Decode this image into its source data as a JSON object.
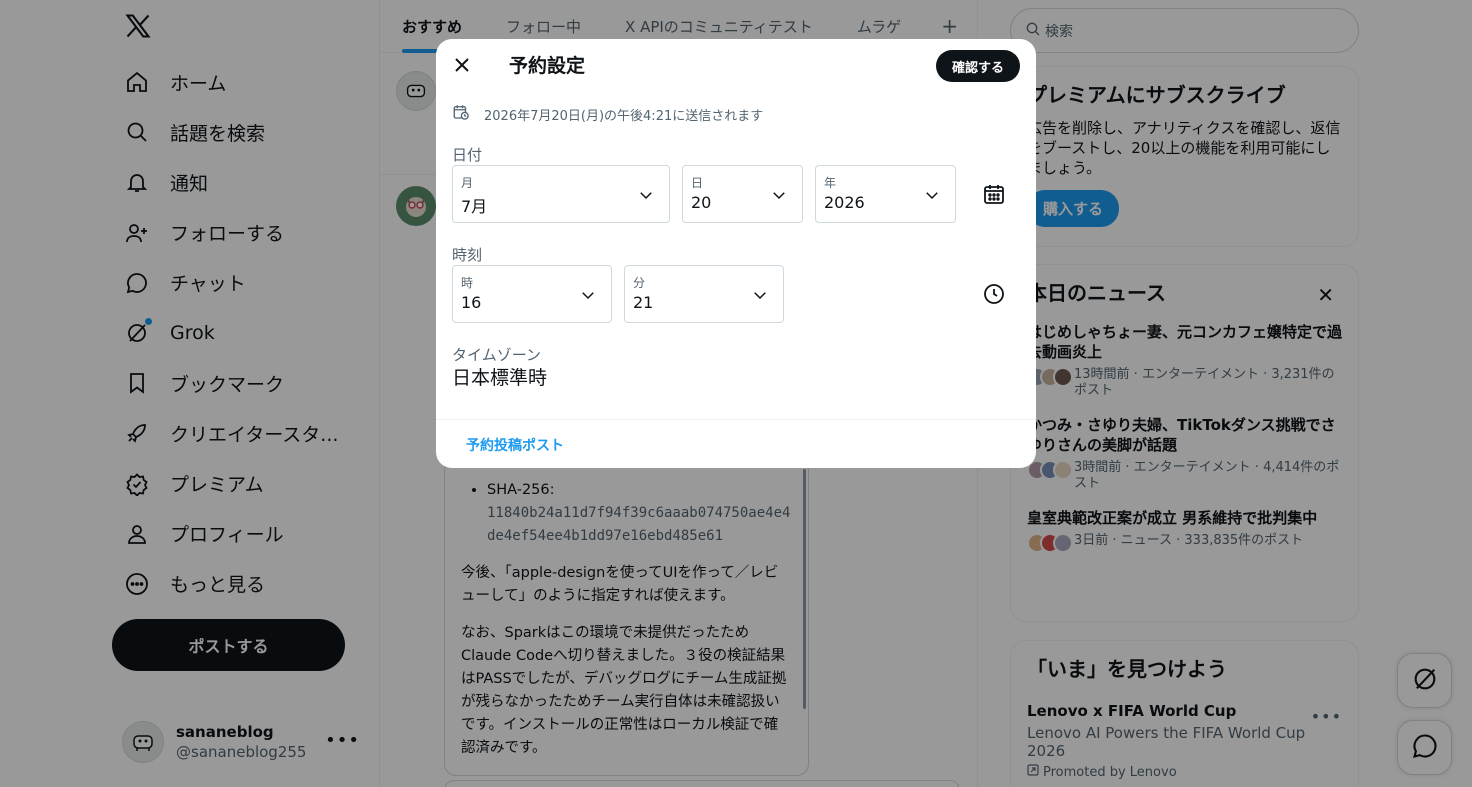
{
  "left_nav": {
    "items": [
      {
        "label": "ホーム",
        "icon": "home-icon"
      },
      {
        "label": "話題を検索",
        "icon": "search-icon"
      },
      {
        "label": "通知",
        "icon": "bell-icon"
      },
      {
        "label": "フォローする",
        "icon": "follow-icon"
      },
      {
        "label": "チャット",
        "icon": "chat-icon"
      },
      {
        "label": "Grok",
        "icon": "grok-icon"
      },
      {
        "label": "ブックマーク",
        "icon": "bookmark-icon"
      },
      {
        "label": "クリエイタースタ...",
        "icon": "rocket-icon"
      },
      {
        "label": "プレミアム",
        "icon": "verified-icon"
      },
      {
        "label": "プロフィール",
        "icon": "person-icon"
      },
      {
        "label": "もっと見る",
        "icon": "more-circle-icon"
      }
    ],
    "post_button": "ポストする",
    "account": {
      "name": "sananeblog",
      "handle": "@sananeblog255"
    }
  },
  "center": {
    "tabs": [
      "おすすめ",
      "フォロー中",
      "X APIのコミュニティテスト",
      "ムラゲ"
    ],
    "tab_add": "+",
    "post": {
      "bullet_label": "SHA-256:",
      "hash": "11840b24a11d7f94f39c6aaab074750ae4e4de4ef54ee4b1dd97e16ebd485e61",
      "para1": "今後、「apple-designを使ってUIを作って／レビューして」のように指定すれば使えます。",
      "para2": "なお、Sparkはこの環境で未提供だったためClaude Codeへ切り替えました。３役の検証結果はPASSでしたが、デバッグログにチーム生成証拠が残らなかったためチーム実行自体は未確認扱いです。インストールの正常性はローカル検証で確認済みです。"
    }
  },
  "right": {
    "search_placeholder": "検索",
    "premium": {
      "title": "プレミアムにサブスクライブ",
      "desc": "広告を削除し、アナリティクスを確認し、返信をブーストし、20以上の機能を利用可能にしましょう。",
      "button": "購入する"
    },
    "news": {
      "title": "本日のニュース",
      "items": [
        {
          "headline": "はじめしゃちょー妻、元コンカフェ嬢特定で過去動画炎上",
          "meta": "13時間前 · エンターテイメント · 3,231件のポスト"
        },
        {
          "headline": "かつみ・さゆり夫婦、TikTokダンス挑戦でさゆりさんの美脚が話題",
          "meta": "3時間前 · エンターテイメント · 4,414件のポスト"
        },
        {
          "headline": "皇室典範改正案が成立 男系維持で批判集中",
          "meta": "3日前 · ニュース · 333,835件のポスト"
        }
      ]
    },
    "explore": {
      "title": "「いま」を見つけよう",
      "promo_title": "Lenovo x FIFA World Cup",
      "promo_sub": "Lenovo AI Powers the FIFA World Cup 2026",
      "promo_by": "Promoted by Lenovo"
    }
  },
  "modal": {
    "title": "予約設定",
    "confirm": "確認する",
    "notice": "2026年7月20日(月)の午後4:21に送信されます",
    "date_label": "日付",
    "month": {
      "label": "月",
      "value": "7月"
    },
    "day": {
      "label": "日",
      "value": "20"
    },
    "year": {
      "label": "年",
      "value": "2026"
    },
    "time_label": "時刻",
    "hour": {
      "label": "時",
      "value": "16"
    },
    "minute": {
      "label": "分",
      "value": "21"
    },
    "timezone_label": "タイムゾーン",
    "timezone_value": "日本標準時",
    "scheduled_link": "予約投稿ポスト"
  },
  "colors": {
    "accent": "#1d9bf0",
    "text": "#0f1419",
    "muted": "#536471",
    "border": "#cfd9de"
  }
}
